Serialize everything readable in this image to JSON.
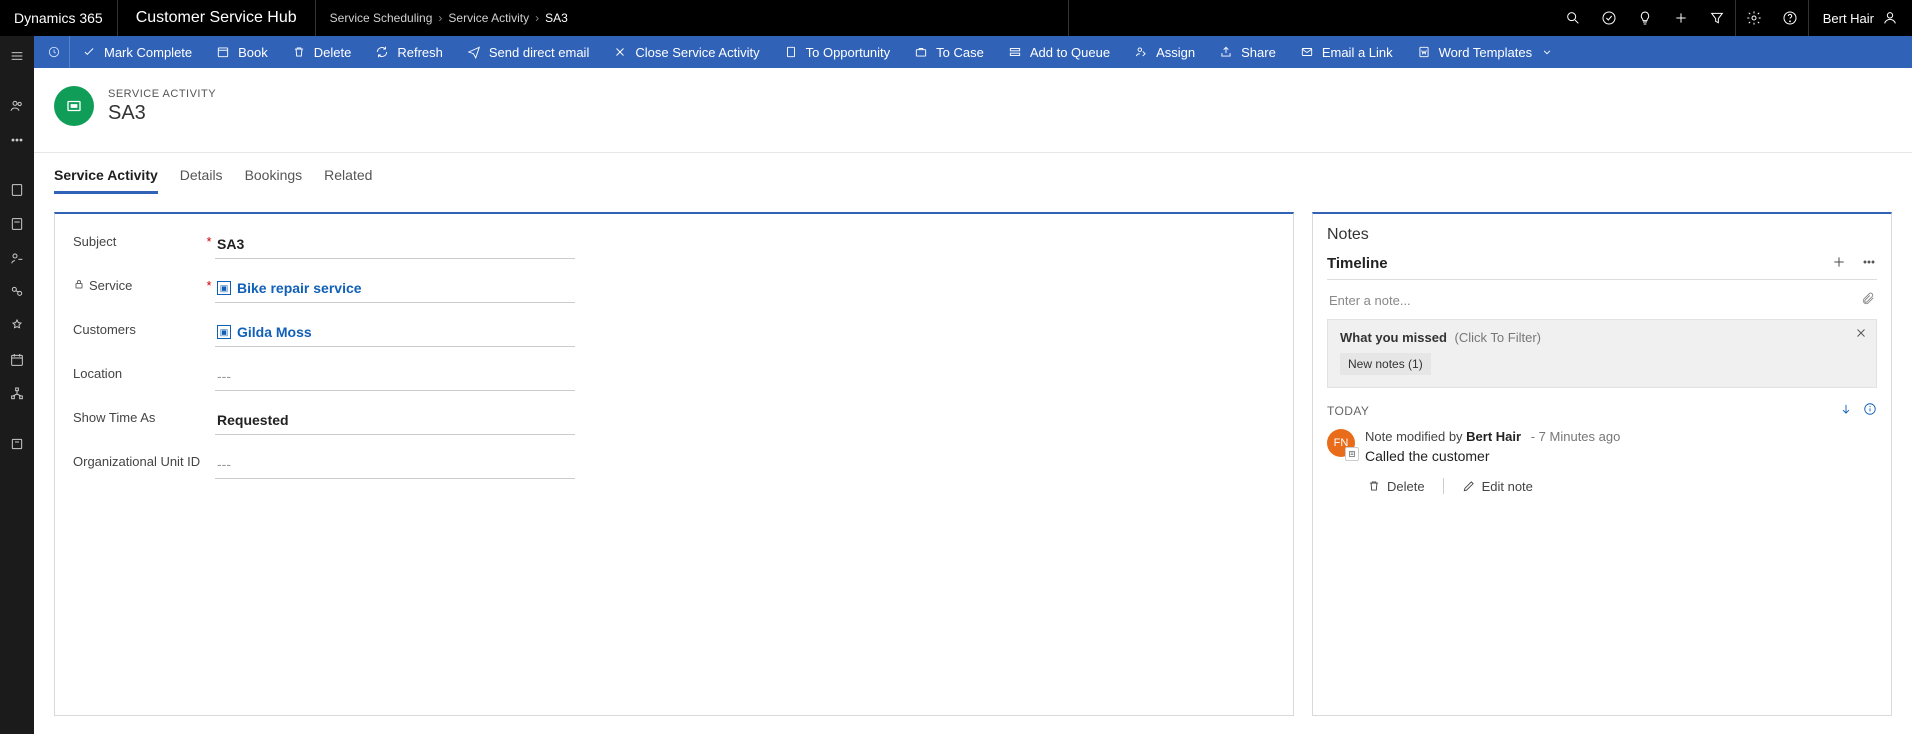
{
  "topbar": {
    "brand": "Dynamics 365",
    "hub": "Customer Service Hub",
    "breadcrumb": [
      "Service Scheduling",
      "Service Activity",
      "SA3"
    ],
    "user": "Bert Hair"
  },
  "commands": {
    "mark_complete": "Mark Complete",
    "book": "Book",
    "delete": "Delete",
    "refresh": "Refresh",
    "send_direct_email": "Send direct email",
    "close_service_activity": "Close Service Activity",
    "to_opportunity": "To Opportunity",
    "to_case": "To Case",
    "add_to_queue": "Add to Queue",
    "assign": "Assign",
    "share": "Share",
    "email_a_link": "Email a Link",
    "word_templates": "Word Templates"
  },
  "header": {
    "kicker": "SERVICE ACTIVITY",
    "title": "SA3"
  },
  "tabs": [
    "Service Activity",
    "Details",
    "Bookings",
    "Related"
  ],
  "form": {
    "subject_label": "Subject",
    "subject_value": "SA3",
    "service_label": "Service",
    "service_value": "Bike repair service",
    "customers_label": "Customers",
    "customers_value": "Gilda Moss",
    "location_label": "Location",
    "location_value": "---",
    "showtime_label": "Show Time As",
    "showtime_value": "Requested",
    "orgunit_label": "Organizational Unit ID",
    "orgunit_value": "---"
  },
  "notes": {
    "heading": "Notes",
    "timeline": "Timeline",
    "enter_placeholder": "Enter a note...",
    "missed_title": "What you missed",
    "missed_hint": "(Click To Filter)",
    "chip": "New notes (1)",
    "today": "TODAY",
    "entry_prefix": "Note modified by ",
    "entry_user": "Bert Hair",
    "entry_when": "7 Minutes ago",
    "entry_text": "Called the customer",
    "delete": "Delete",
    "edit": "Edit note",
    "avatar_initials": "FN"
  }
}
